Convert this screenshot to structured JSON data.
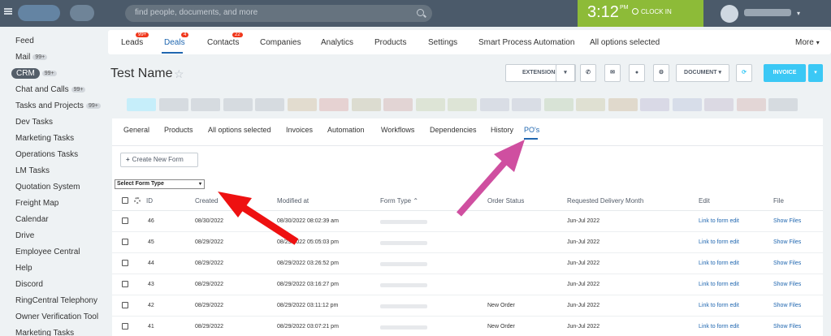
{
  "topbar": {
    "search_placeholder": "find people, documents, and more",
    "clock_time": "3:12",
    "clock_period": "PM",
    "clock_in_label": "CLOCK IN",
    "user_caret": "▾"
  },
  "left_menu": {
    "items": [
      {
        "label": "Feed",
        "badge": ""
      },
      {
        "label": "Mail",
        "badge": "99+"
      },
      {
        "label": "CRM",
        "badge": "99+"
      },
      {
        "label": "Chat and Calls",
        "badge": "99+"
      },
      {
        "label": "Tasks and Projects",
        "badge": "99+"
      },
      {
        "label": "Dev Tasks",
        "badge": ""
      },
      {
        "label": "Marketing Tasks",
        "badge": ""
      },
      {
        "label": "Operations Tasks",
        "badge": ""
      },
      {
        "label": "LM Tasks",
        "badge": ""
      },
      {
        "label": "Quotation System",
        "badge": ""
      },
      {
        "label": "Freight Map",
        "badge": ""
      },
      {
        "label": "Calendar",
        "badge": ""
      },
      {
        "label": "Drive",
        "badge": ""
      },
      {
        "label": "Employee Central",
        "badge": ""
      },
      {
        "label": "Help",
        "badge": ""
      },
      {
        "label": "Discord",
        "badge": ""
      },
      {
        "label": "RingCentral Telephony",
        "badge": ""
      },
      {
        "label": "Owner Verification Tool",
        "badge": ""
      },
      {
        "label": "Marketing Tasks",
        "badge": ""
      }
    ]
  },
  "crm_tabs": {
    "items": [
      {
        "label": "Leads",
        "badge": "99+"
      },
      {
        "label": "Deals",
        "badge": "4"
      },
      {
        "label": "Contacts",
        "badge": "22"
      },
      {
        "label": "Companies",
        "badge": ""
      },
      {
        "label": "Analytics",
        "badge": ""
      },
      {
        "label": "Products",
        "badge": ""
      },
      {
        "label": "Settings",
        "badge": ""
      },
      {
        "label": "Smart Process Automation",
        "badge": ""
      },
      {
        "label": "All options selected",
        "badge": ""
      },
      {
        "label": "More",
        "badge": ""
      }
    ],
    "more_caret": "▾"
  },
  "page": {
    "title": "Test Name",
    "star": "☆"
  },
  "toolbar": {
    "extensions_label": "EXTENSIONS",
    "extensions_caret": "▾",
    "document_label": "DOCUMENT",
    "document_caret": "▾",
    "invoice_label": "INVOICE",
    "invoice_caret": "▾",
    "phone_icon": "✆",
    "mail_icon": "✉",
    "chat_icon": "●",
    "gear_icon": "⚙",
    "sync_icon": "⟳"
  },
  "stages": [
    {
      "color": "#c6eefa"
    },
    {
      "color": "#d6dbe0"
    },
    {
      "color": "#d6dbe0"
    },
    {
      "color": "#d6dbe0"
    },
    {
      "color": "#d6dbe0"
    },
    {
      "color": "#e2dccf"
    },
    {
      "color": "#e6d2d2"
    },
    {
      "color": "#dcdcd0"
    },
    {
      "color": "#e2d4d4"
    },
    {
      "color": "#dde4d6"
    },
    {
      "color": "#dde4d6"
    },
    {
      "color": "#d9dde5"
    },
    {
      "color": "#d9dde5"
    },
    {
      "color": "#d8e3d6"
    },
    {
      "color": "#dfe0d2"
    },
    {
      "color": "#e0d9cc"
    },
    {
      "color": "#d9d9e6"
    },
    {
      "color": "#d7dde9"
    },
    {
      "color": "#dbd9e3"
    },
    {
      "color": "#e3d6d6"
    },
    {
      "color": "#d6dbe0"
    }
  ],
  "card_tabs": {
    "items": [
      "General",
      "Products",
      "All options selected",
      "Invoices",
      "Automation",
      "Workflows",
      "Dependencies",
      "History",
      "PO's"
    ]
  },
  "form": {
    "create_label": "Create New Form",
    "create_icon": "+",
    "select_label": "Select Form Type",
    "select_caret": "▾"
  },
  "table": {
    "headers": {
      "id": "ID",
      "created": "Created",
      "modified": "Modified at",
      "form_type": "Form Type",
      "sort": "⌃",
      "status": "Order Status",
      "delivery": "Requested Delivery Month",
      "edit": "Edit",
      "file": "File"
    },
    "rows": [
      {
        "id": "46",
        "created": "08/30/2022",
        "modified": "08/30/2022 08:02:39 am",
        "status": "",
        "delivery": "Jun-Jul 2022",
        "edit": "Link to form edit",
        "file": "Show Files"
      },
      {
        "id": "45",
        "created": "08/29/2022",
        "modified": "08/29/2022 05:05:03 pm",
        "status": "",
        "delivery": "Jun-Jul 2022",
        "edit": "Link to form edit",
        "file": "Show Files"
      },
      {
        "id": "44",
        "created": "08/29/2022",
        "modified": "08/29/2022 03:26:52 pm",
        "status": "",
        "delivery": "Jun-Jul 2022",
        "edit": "Link to form edit",
        "file": "Show Files"
      },
      {
        "id": "43",
        "created": "08/29/2022",
        "modified": "08/29/2022 03:16:27 pm",
        "status": "",
        "delivery": "Jun-Jul 2022",
        "edit": "Link to form edit",
        "file": "Show Files"
      },
      {
        "id": "42",
        "created": "08/29/2022",
        "modified": "08/29/2022 03:11:12 pm",
        "status": "New Order",
        "delivery": "Jun-Jul 2022",
        "edit": "Link to form edit",
        "file": "Show Files"
      },
      {
        "id": "41",
        "created": "08/29/2022",
        "modified": "08/29/2022 03:07:21 pm",
        "status": "New Order",
        "delivery": "Jun-Jul 2022",
        "edit": "Link to form edit",
        "file": "Show Files"
      }
    ]
  },
  "colors": {
    "accent": "#2067b0",
    "invoice": "#3bc8f5",
    "clock": "#8dbb38",
    "topbar": "#4b5a6a",
    "arrow_red": "#ee1111",
    "arrow_pink": "#cf4fa0"
  }
}
